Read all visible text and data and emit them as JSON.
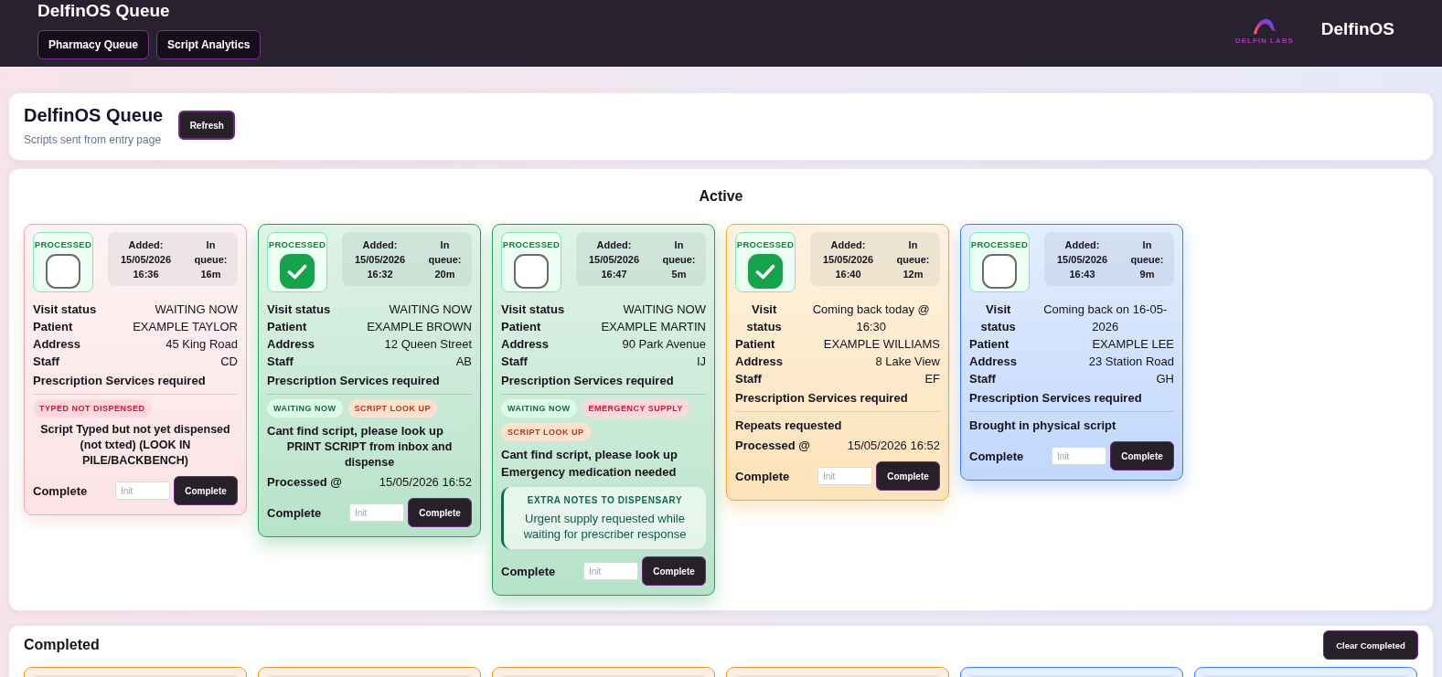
{
  "header": {
    "title": "DelfinOS Queue",
    "nav": [
      "Pharmacy Queue",
      "Script Analytics"
    ],
    "logo_caption": "DELFIN LABS",
    "brand": "DelfinOS"
  },
  "queue_panel": {
    "title": "DelfinOS Queue",
    "subtitle": "Scripts sent from entry page",
    "refresh_button": "Refresh"
  },
  "active": {
    "title": "Active",
    "cards": [
      {
        "color": "#f6a9b0",
        "processed_label": "PROCESSED",
        "processed": false,
        "added": "Added: 15/05/2026 16:36",
        "in_queue": "In queue: 16m",
        "fields": [
          {
            "label": "Visit status",
            "value": "WAITING NOW"
          },
          {
            "label": "Patient",
            "value": "EXAMPLE TAYLOR"
          },
          {
            "label": "Address",
            "value": "45 King Road"
          },
          {
            "label": "Staff",
            "value": "CD"
          }
        ],
        "services_title": "Prescription Services required",
        "tags": [
          {
            "text": "TYPED NOT DISPENSED",
            "kind": "danger"
          }
        ],
        "services": [
          {
            "text": "Script Typed but not yet dispensed (not txted) (LOOK IN PILE/BACKBENCH)",
            "kind": "instruction"
          }
        ],
        "complete": {
          "label": "Complete",
          "placeholder": "Init",
          "button": "Complete"
        }
      },
      {
        "color": "#1ea557",
        "processed_label": "PROCESSED",
        "processed": true,
        "added": "Added: 15/05/2026 16:32",
        "in_queue": "In queue: 20m",
        "fields": [
          {
            "label": "Visit status",
            "value": "WAITING NOW"
          },
          {
            "label": "Patient",
            "value": "EXAMPLE BROWN"
          },
          {
            "label": "Address",
            "value": "12 Queen Street"
          },
          {
            "label": "Staff",
            "value": "AB"
          }
        ],
        "services_title": "Prescription Services required",
        "tags": [
          {
            "text": "WAITING NOW",
            "kind": "success"
          },
          {
            "text": "SCRIPT LOOK UP",
            "kind": "warning"
          }
        ],
        "services": [
          {
            "text": "Cant find script, please look up",
            "kind": "line"
          },
          {
            "text": "PRINT SCRIPT from inbox and dispense",
            "kind": "instruction"
          }
        ],
        "processed_at": {
          "label": "Processed @",
          "value": "15/05/2026 16:52"
        },
        "complete": {
          "label": "Complete",
          "placeholder": "Init",
          "button": "Complete"
        }
      },
      {
        "color": "#1ea557",
        "processed_label": "PROCESSED",
        "processed": false,
        "added": "Added: 15/05/2026 16:47",
        "in_queue": "In queue: 5m",
        "fields": [
          {
            "label": "Visit status",
            "value": "WAITING NOW"
          },
          {
            "label": "Patient",
            "value": "EXAMPLE MARTIN"
          },
          {
            "label": "Address",
            "value": "90 Park Avenue"
          },
          {
            "label": "Staff",
            "value": "IJ"
          }
        ],
        "services_title": "Prescription Services required",
        "tags": [
          {
            "text": "WAITING NOW",
            "kind": "success"
          },
          {
            "text": "EMERGENCY SUPPLY",
            "kind": "danger"
          },
          {
            "text": "SCRIPT LOOK UP",
            "kind": "warning"
          }
        ],
        "services": [
          {
            "text": "Cant find script, please look up",
            "kind": "line"
          },
          {
            "text": "Emergency medication needed",
            "kind": "line"
          }
        ],
        "notes": {
          "title": "EXTRA NOTES TO DISPENSARY",
          "text": "Urgent supply requested while waiting for prescriber response"
        },
        "complete": {
          "label": "Complete",
          "placeholder": "Init",
          "button": "Complete"
        }
      },
      {
        "color": "#f5a623",
        "processed_label": "PROCESSED",
        "processed": true,
        "added": "Added: 15/05/2026 16:40",
        "in_queue": "In queue: 12m",
        "fields": [
          {
            "label": "Visit status",
            "value": "Coming back today @ 16:30"
          },
          {
            "label": "Patient",
            "value": "EXAMPLE WILLIAMS"
          },
          {
            "label": "Address",
            "value": "8 Lake View"
          },
          {
            "label": "Staff",
            "value": "EF"
          }
        ],
        "services_title": "Prescription Services required",
        "services": [
          {
            "text": "Repeats requested",
            "kind": "line"
          }
        ],
        "processed_at": {
          "label": "Processed @",
          "value": "15/05/2026 16:52"
        },
        "complete": {
          "label": "Complete",
          "placeholder": "Init",
          "button": "Complete"
        }
      },
      {
        "color": "#3b82f6",
        "processed_label": "PROCESSED",
        "processed": false,
        "added": "Added: 15/05/2026 16:43",
        "in_queue": "In queue: 9m",
        "fields": [
          {
            "label": "Visit status",
            "value": "Coming back on 16-05-2026"
          },
          {
            "label": "Patient",
            "value": "EXAMPLE LEE"
          },
          {
            "label": "Address",
            "value": "23 Station Road"
          },
          {
            "label": "Staff",
            "value": "GH"
          }
        ],
        "services_title": "Prescription Services required",
        "services": [
          {
            "text": "Brought in physical script",
            "kind": "line"
          }
        ],
        "complete": {
          "label": "Complete",
          "placeholder": "Init",
          "button": "Complete"
        }
      }
    ]
  },
  "completed": {
    "title": "Completed",
    "clear_button": "Clear Completed",
    "cards": [
      {
        "color": "#f0902a"
      },
      {
        "color": "#f0902a"
      },
      {
        "color": "#f0902a"
      },
      {
        "color": "#f0902a"
      },
      {
        "color": "#3b82f6"
      },
      {
        "color": "#3b82f6"
      }
    ]
  }
}
